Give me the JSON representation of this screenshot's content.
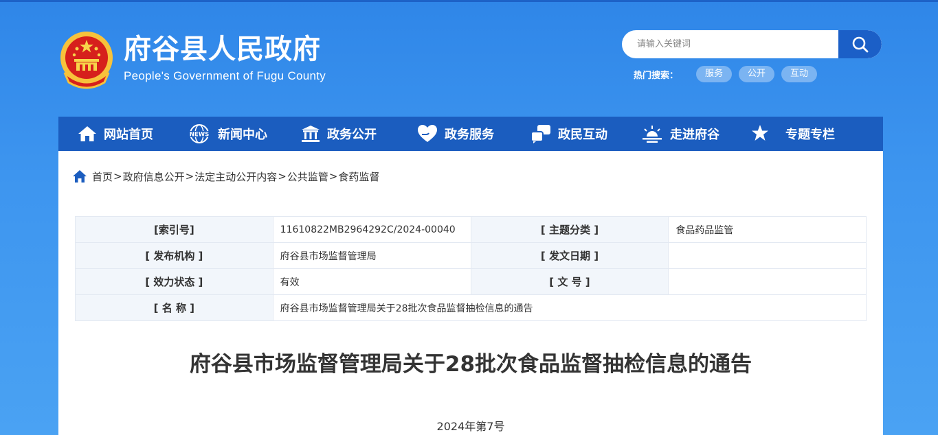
{
  "header": {
    "title": "府谷县人民政府",
    "subtitle": "People's Government of Fugu County",
    "search_placeholder": "请输入关键词",
    "hot_label": "热门搜索：",
    "hot_tags": [
      "服务",
      "公开",
      "互动"
    ]
  },
  "nav": {
    "items": [
      {
        "label": "网站首页",
        "icon": "home-icon"
      },
      {
        "label": "新闻中心",
        "icon": "news-icon"
      },
      {
        "label": "政务公开",
        "icon": "government-building-icon"
      },
      {
        "label": "政务服务",
        "icon": "heart-hand-icon"
      },
      {
        "label": "政民互动",
        "icon": "interaction-icon"
      },
      {
        "label": "走进府谷",
        "icon": "sunrise-icon"
      },
      {
        "label": "专题专栏",
        "icon": "star-trophy-icon"
      }
    ]
  },
  "breadcrumb": {
    "items": [
      "首页",
      "政府信息公开",
      "法定主动公开内容",
      "公共监管",
      "食药监督"
    ],
    "separator": ">"
  },
  "meta": {
    "index_key": "[索引号]",
    "index_value": "11610822MB2964292C/2024-00040",
    "topic_key": "[ 主题分类 ]",
    "topic_value": "食品药品监管",
    "issuer_key": "[ 发布机构 ]",
    "issuer_value": "府谷县市场监督管理局",
    "date_key": "[ 发文日期 ]",
    "date_value": "",
    "status_key": "[ 效力状态 ]",
    "status_value": "有效",
    "docno_key": "[ 文 号 ]",
    "docno_value": "",
    "name_key": "[ 名 称 ]",
    "name_value": "府谷县市场监督管理局关于28批次食品监督抽检信息的通告"
  },
  "document": {
    "title": "府谷县市场监督管理局关于28批次食品监督抽检信息的通告",
    "number": "2024年第7号"
  },
  "colors": {
    "header_bg": "#3d95ef",
    "nav_bg": "#1b5dbf",
    "search_button": "#1b5fc7",
    "table_key_bg": "#f2f6fb"
  }
}
